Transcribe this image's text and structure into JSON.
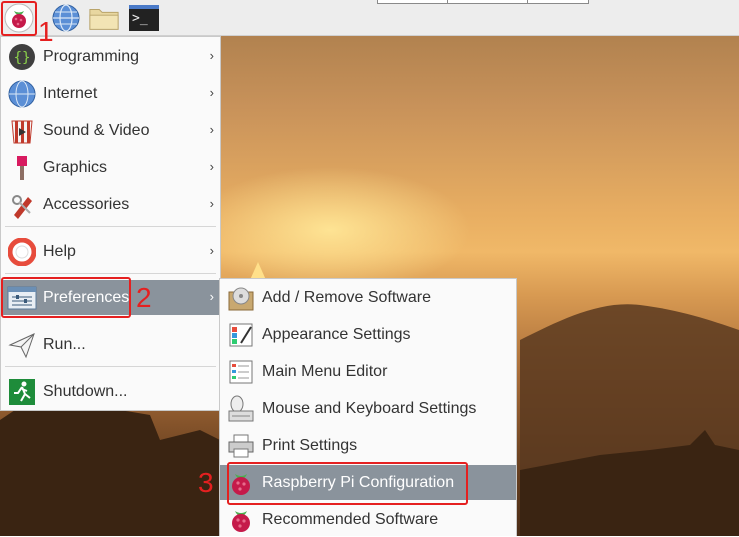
{
  "taskbar": {
    "buttons": [
      {
        "name": "raspberry-menu-icon"
      },
      {
        "name": "web-browser-icon"
      },
      {
        "name": "file-manager-icon"
      },
      {
        "name": "terminal-icon",
        "glyph": ">_"
      }
    ]
  },
  "main_menu": {
    "items": [
      {
        "label": "Programming",
        "icon": "programming-icon"
      },
      {
        "label": "Internet",
        "icon": "internet-icon"
      },
      {
        "label": "Sound & Video",
        "icon": "sound-video-icon"
      },
      {
        "label": "Graphics",
        "icon": "graphics-icon"
      },
      {
        "label": "Accessories",
        "icon": "accessories-icon"
      },
      {
        "label": "Help",
        "icon": "help-icon"
      },
      {
        "label": "Preferences",
        "icon": "preferences-icon"
      },
      {
        "label": "Run...",
        "icon": "run-icon"
      },
      {
        "label": "Shutdown...",
        "icon": "shutdown-icon"
      }
    ]
  },
  "submenu": {
    "items": [
      {
        "label": "Add / Remove Software",
        "icon": "add-remove-software-icon"
      },
      {
        "label": "Appearance Settings",
        "icon": "appearance-settings-icon"
      },
      {
        "label": "Main Menu Editor",
        "icon": "main-menu-editor-icon"
      },
      {
        "label": "Mouse and Keyboard Settings",
        "icon": "mouse-keyboard-icon"
      },
      {
        "label": "Print Settings",
        "icon": "printer-icon"
      },
      {
        "label": "Raspberry Pi Configuration",
        "icon": "raspberry-pi-config-icon"
      },
      {
        "label": "Recommended Software",
        "icon": "recommended-software-icon"
      }
    ]
  },
  "annotations": {
    "one": "1",
    "two": "2",
    "three": "3"
  },
  "colors": {
    "annotation": "#e52020",
    "selection": "#8a939c"
  }
}
